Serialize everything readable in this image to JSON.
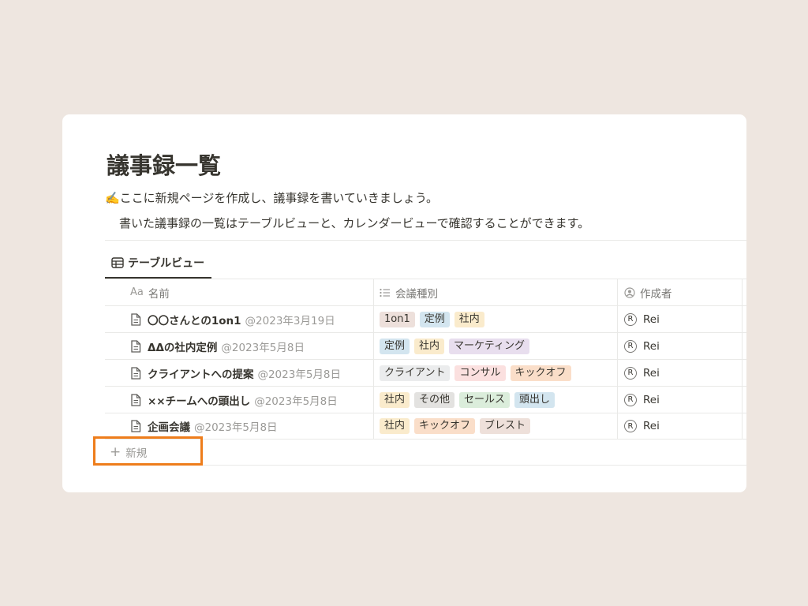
{
  "page": {
    "title": "議事録一覧",
    "description_line1": "✍️ここに新規ページを作成し、議事録を書いていきましょう。",
    "description_line2": "書いた議事録の一覧はテーブルビューと、カレンダービューで確認することができます。"
  },
  "view_tab": {
    "label": "テーブルビュー",
    "icon": "table-icon"
  },
  "table": {
    "columns": [
      {
        "label": "名前",
        "icon_text": "Aa"
      },
      {
        "label": "会議種別",
        "icon": "list-icon"
      },
      {
        "label": "作成者",
        "icon": "person-icon"
      }
    ],
    "rows": [
      {
        "name": "〇〇さんとの1on1",
        "date": "@2023年3月19日",
        "tags": [
          "1on1",
          "定例",
          "社内"
        ],
        "author_initial": "R",
        "author": "Rei"
      },
      {
        "name": "ΔΔの社内定例",
        "date": "@2023年5月8日",
        "tags": [
          "定例",
          "社内",
          "マーケティング"
        ],
        "author_initial": "R",
        "author": "Rei"
      },
      {
        "name": "クライアントへの提案",
        "date": "@2023年5月8日",
        "tags": [
          "クライアント",
          "コンサル",
          "キックオフ"
        ],
        "author_initial": "R",
        "author": "Rei"
      },
      {
        "name": "××チームへの頭出し",
        "date": "@2023年5月8日",
        "tags": [
          "社内",
          "その他",
          "セールス",
          "頭出し"
        ],
        "author_initial": "R",
        "author": "Rei"
      },
      {
        "name": "企画会議",
        "date": "@2023年5月8日",
        "tags": [
          "社内",
          "キックオフ",
          "ブレスト"
        ],
        "author_initial": "R",
        "author": "Rei"
      }
    ],
    "new_label": "新規"
  },
  "tag_colors": {
    "1on1": "#EDE0DB",
    "定例": "#D3E5EF",
    "社内": "#FAEBCC",
    "マーケティング": "#E8DEEE",
    "クライアント": "#EBECED",
    "コンサル": "#FBE0DF",
    "キックオフ": "#FADEC9",
    "その他": "#E3E2E0",
    "セールス": "#DBEDDB",
    "頭出し": "#D3E5EF",
    "ブレスト": "#EEE0DA"
  },
  "highlight_color": "#EE7D1B"
}
